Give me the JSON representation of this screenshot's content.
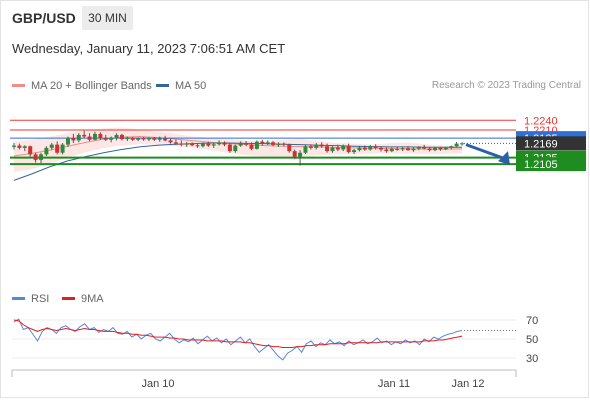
{
  "header": {
    "pair": "GBP/USD",
    "timeframe": "30 MIN",
    "datetime": "Wednesday, January 11, 2023 7:06:51 AM CET"
  },
  "legend": {
    "main": [
      {
        "label": "MA 20 + Bollinger Bands",
        "color": "#f08c84"
      },
      {
        "label": "MA 50",
        "color": "#35669b"
      }
    ],
    "rsi": [
      {
        "label": "RSI",
        "color": "#5b86d6"
      },
      {
        "label": "9MA",
        "color": "#e02020"
      }
    ]
  },
  "credit": "Research © 2023 Trading Central",
  "colors": {
    "resistance": "#e53935",
    "support": "#1e8c1e",
    "pivot": "#2f6fd6",
    "price": "#333333",
    "candle_up": "#2e8b3d",
    "candle_down": "#d32f2f",
    "arrow": "#2b5fa8"
  },
  "chart_data": [
    {
      "type": "candlestick",
      "ylim": [
        1.2051,
        1.2262
      ],
      "x_tick_labels": [
        "Jan 10",
        "Jan 11",
        "Jan 12"
      ],
      "levels": [
        {
          "value": 1.224,
          "label": "1.2240",
          "kind": "resistance"
        },
        {
          "value": 1.221,
          "label": "1.2210",
          "kind": "resistance"
        },
        {
          "value": 1.2185,
          "label": "1.2185",
          "kind": "pivot"
        },
        {
          "value": 1.2169,
          "label": "1.2169",
          "kind": "last_price"
        },
        {
          "value": 1.2125,
          "label": "1.2125",
          "kind": "support"
        },
        {
          "value": 1.2105,
          "label": "1.2105",
          "kind": "support"
        }
      ],
      "forecast_arrow": {
        "from": 1.2165,
        "to": 1.2102,
        "direction": "down"
      },
      "ohlc": [
        [
          1.2158,
          1.217,
          1.215,
          1.2162
        ],
        [
          1.2162,
          1.2168,
          1.215,
          1.2155
        ],
        [
          1.2155,
          1.2163,
          1.2145,
          1.216
        ],
        [
          1.216,
          1.2162,
          1.2128,
          1.2135
        ],
        [
          1.2135,
          1.214,
          1.211,
          1.2118
        ],
        [
          1.2118,
          1.214,
          1.2108,
          1.2135
        ],
        [
          1.2135,
          1.216,
          1.213,
          1.2155
        ],
        [
          1.2155,
          1.217,
          1.2148,
          1.2165
        ],
        [
          1.2165,
          1.2175,
          1.2135,
          1.214
        ],
        [
          1.214,
          1.217,
          1.2135,
          1.2165
        ],
        [
          1.2165,
          1.219,
          1.2158,
          1.2185
        ],
        [
          1.2185,
          1.2198,
          1.217,
          1.2178
        ],
        [
          1.2178,
          1.22,
          1.2172,
          1.2195
        ],
        [
          1.2195,
          1.2208,
          1.2185,
          1.219
        ],
        [
          1.219,
          1.22,
          1.2176,
          1.218
        ],
        [
          1.218,
          1.2205,
          1.2178,
          1.2198
        ],
        [
          1.2198,
          1.2203,
          1.218,
          1.2185
        ],
        [
          1.2185,
          1.2195,
          1.2176,
          1.218
        ],
        [
          1.218,
          1.219,
          1.2172,
          1.2186
        ],
        [
          1.2186,
          1.22,
          1.2178,
          1.2195
        ],
        [
          1.2195,
          1.2198,
          1.2178,
          1.2182
        ],
        [
          1.2182,
          1.219,
          1.2176,
          1.2186
        ],
        [
          1.2186,
          1.2188,
          1.2176,
          1.218
        ],
        [
          1.218,
          1.2187,
          1.2176,
          1.2184
        ],
        [
          1.2184,
          1.2188,
          1.2177,
          1.2181
        ],
        [
          1.2181,
          1.2187,
          1.2176,
          1.2185
        ],
        [
          1.2185,
          1.2188,
          1.2176,
          1.218
        ],
        [
          1.218,
          1.219,
          1.2174,
          1.2184
        ],
        [
          1.2184,
          1.2192,
          1.2175,
          1.2178
        ],
        [
          1.2178,
          1.2184,
          1.2168,
          1.2172
        ],
        [
          1.2172,
          1.218,
          1.2164,
          1.2168
        ],
        [
          1.2168,
          1.2178,
          1.216,
          1.2165
        ],
        [
          1.2165,
          1.2173,
          1.2158,
          1.2168
        ],
        [
          1.2168,
          1.2172,
          1.216,
          1.2163
        ],
        [
          1.2163,
          1.2169,
          1.2155,
          1.216
        ],
        [
          1.216,
          1.2172,
          1.2156,
          1.2168
        ],
        [
          1.2168,
          1.2174,
          1.2158,
          1.2162
        ],
        [
          1.2162,
          1.217,
          1.2155,
          1.2166
        ],
        [
          1.2166,
          1.2178,
          1.2162,
          1.2172
        ],
        [
          1.2172,
          1.2175,
          1.216,
          1.2165
        ],
        [
          1.2165,
          1.217,
          1.214,
          1.2145
        ],
        [
          1.2145,
          1.2165,
          1.214,
          1.2162
        ],
        [
          1.2162,
          1.2175,
          1.2158,
          1.217
        ],
        [
          1.217,
          1.2176,
          1.216,
          1.2165
        ],
        [
          1.2165,
          1.2172,
          1.2148,
          1.2152
        ],
        [
          1.2152,
          1.2178,
          1.215,
          1.2174
        ],
        [
          1.2174,
          1.218,
          1.2162,
          1.2168
        ],
        [
          1.2168,
          1.2178,
          1.2164,
          1.2172
        ],
        [
          1.2172,
          1.2176,
          1.216,
          1.2164
        ],
        [
          1.2164,
          1.2172,
          1.2158,
          1.2168
        ],
        [
          1.2168,
          1.2172,
          1.216,
          1.2165
        ],
        [
          1.2165,
          1.2168,
          1.214,
          1.2145
        ],
        [
          1.2145,
          1.215,
          1.212,
          1.2128
        ],
        [
          1.2128,
          1.2148,
          1.21,
          1.214
        ],
        [
          1.214,
          1.2165,
          1.2136,
          1.216
        ],
        [
          1.216,
          1.2166,
          1.215,
          1.2155
        ],
        [
          1.2155,
          1.217,
          1.215,
          1.2165
        ],
        [
          1.2165,
          1.2172,
          1.2155,
          1.216
        ],
        [
          1.216,
          1.2168,
          1.214,
          1.2145
        ],
        [
          1.2145,
          1.216,
          1.214,
          1.2156
        ],
        [
          1.2156,
          1.2165,
          1.2145,
          1.215
        ],
        [
          1.215,
          1.2165,
          1.2145,
          1.2162
        ],
        [
          1.2162,
          1.2168,
          1.2138,
          1.2142
        ],
        [
          1.2142,
          1.2152,
          1.2136,
          1.2148
        ],
        [
          1.2148,
          1.216,
          1.2144,
          1.2156
        ],
        [
          1.2156,
          1.2162,
          1.2146,
          1.215
        ],
        [
          1.215,
          1.2164,
          1.2146,
          1.216
        ],
        [
          1.216,
          1.2166,
          1.215,
          1.2155
        ],
        [
          1.2155,
          1.216,
          1.2144,
          1.215
        ],
        [
          1.215,
          1.2156,
          1.214,
          1.2145
        ],
        [
          1.2145,
          1.2156,
          1.2142,
          1.2152
        ],
        [
          1.2152,
          1.2158,
          1.2146,
          1.215
        ],
        [
          1.215,
          1.2157,
          1.2145,
          1.2154
        ],
        [
          1.2154,
          1.216,
          1.2146,
          1.2148
        ],
        [
          1.2148,
          1.2156,
          1.2143,
          1.2153
        ],
        [
          1.2153,
          1.216,
          1.2148,
          1.2158
        ],
        [
          1.2158,
          1.2164,
          1.215,
          1.2153
        ],
        [
          1.2153,
          1.2158,
          1.2144,
          1.2148
        ],
        [
          1.2148,
          1.2158,
          1.2145,
          1.2155
        ],
        [
          1.2155,
          1.2158,
          1.2146,
          1.215
        ],
        [
          1.215,
          1.2158,
          1.2148,
          1.2155
        ],
        [
          1.2155,
          1.2162,
          1.215,
          1.216
        ],
        [
          1.216,
          1.2173,
          1.2158,
          1.2168
        ],
        [
          1.2168,
          1.2172,
          1.2162,
          1.2169
        ]
      ],
      "bollinger": {
        "upper": [
          1.2175,
          1.218,
          1.219,
          1.22,
          1.221,
          1.2215,
          1.2218,
          1.2212,
          1.2205,
          1.2198,
          1.219,
          1.2186,
          1.2182,
          1.2178,
          1.2176,
          1.218,
          1.2182,
          1.2176,
          1.217,
          1.2168,
          1.2165,
          1.217,
          1.2172,
          1.2166,
          1.2162,
          1.216
        ],
        "middle": [
          1.213,
          1.2138,
          1.2148,
          1.216,
          1.2172,
          1.2182,
          1.2188,
          1.219,
          1.2187,
          1.2182,
          1.2177,
          1.2172,
          1.2168,
          1.2165,
          1.2162,
          1.216,
          1.2159,
          1.2158,
          1.2156,
          1.2155,
          1.2154,
          1.2153,
          1.2152,
          1.2151,
          1.2151,
          1.2152
        ],
        "lower": [
          1.208,
          1.209,
          1.2105,
          1.2125,
          1.2142,
          1.2155,
          1.2162,
          1.2166,
          1.2165,
          1.216,
          1.2155,
          1.2148,
          1.214,
          1.2132,
          1.2128,
          1.2128,
          1.213,
          1.2132,
          1.2135,
          1.2136,
          1.2138,
          1.2138,
          1.2137,
          1.2136,
          1.2137,
          1.2138
        ]
      },
      "ma50": [
        1.2055,
        1.2075,
        1.2097,
        1.2115,
        1.2128,
        1.214,
        1.215,
        1.2158,
        1.2163,
        1.2166,
        1.2168,
        1.217,
        1.217,
        1.2169,
        1.2168,
        1.2166,
        1.2165,
        1.2163,
        1.2162,
        1.216,
        1.2159,
        1.2158,
        1.2158,
        1.2157,
        1.2157,
        1.2157
      ]
    },
    {
      "type": "line",
      "ylim": [
        18,
        77
      ],
      "y_ticks": [
        30,
        50,
        70
      ],
      "series": [
        {
          "name": "RSI",
          "values": [
            68,
            71,
            60,
            62,
            55,
            48,
            58,
            62,
            60,
            56,
            62,
            64,
            60,
            58,
            63,
            66,
            60,
            62,
            57,
            60,
            58,
            62,
            56,
            55,
            58,
            52,
            55,
            50,
            54,
            56,
            50,
            48,
            52,
            56,
            50,
            46,
            49,
            47,
            51,
            45,
            49,
            53,
            48,
            51,
            46,
            50,
            44,
            48,
            52,
            46,
            50,
            42,
            36,
            40,
            44,
            38,
            32,
            28,
            35,
            38,
            42,
            36,
            45,
            48,
            42,
            46,
            44,
            49,
            45,
            47,
            43,
            48,
            44,
            46,
            49,
            45,
            47,
            51,
            46,
            48,
            44,
            47,
            45,
            49,
            46,
            48,
            44,
            50,
            47,
            52,
            50,
            53,
            55,
            56,
            58,
            59
          ]
        },
        {
          "name": "9MA",
          "values": [
            70,
            69,
            65,
            62,
            60,
            58,
            60,
            61,
            60,
            59,
            60,
            61,
            60,
            59,
            60,
            61,
            60,
            60,
            59,
            58,
            58,
            58,
            57,
            56,
            56,
            55,
            55,
            54,
            54,
            53,
            52,
            52,
            52,
            51,
            51,
            50,
            50,
            49,
            49,
            49,
            49,
            48,
            48,
            48,
            48,
            47,
            47,
            47,
            47,
            46,
            46,
            45,
            44,
            43,
            43,
            42,
            42,
            41,
            41,
            41,
            42,
            42,
            43,
            43,
            44,
            44,
            44,
            45,
            45,
            45,
            45,
            46,
            46,
            46,
            46,
            46,
            46,
            46,
            47,
            47,
            47,
            47,
            47,
            47,
            47,
            47,
            47,
            48,
            48,
            48,
            49,
            49,
            50,
            51,
            52,
            53
          ]
        }
      ]
    }
  ]
}
